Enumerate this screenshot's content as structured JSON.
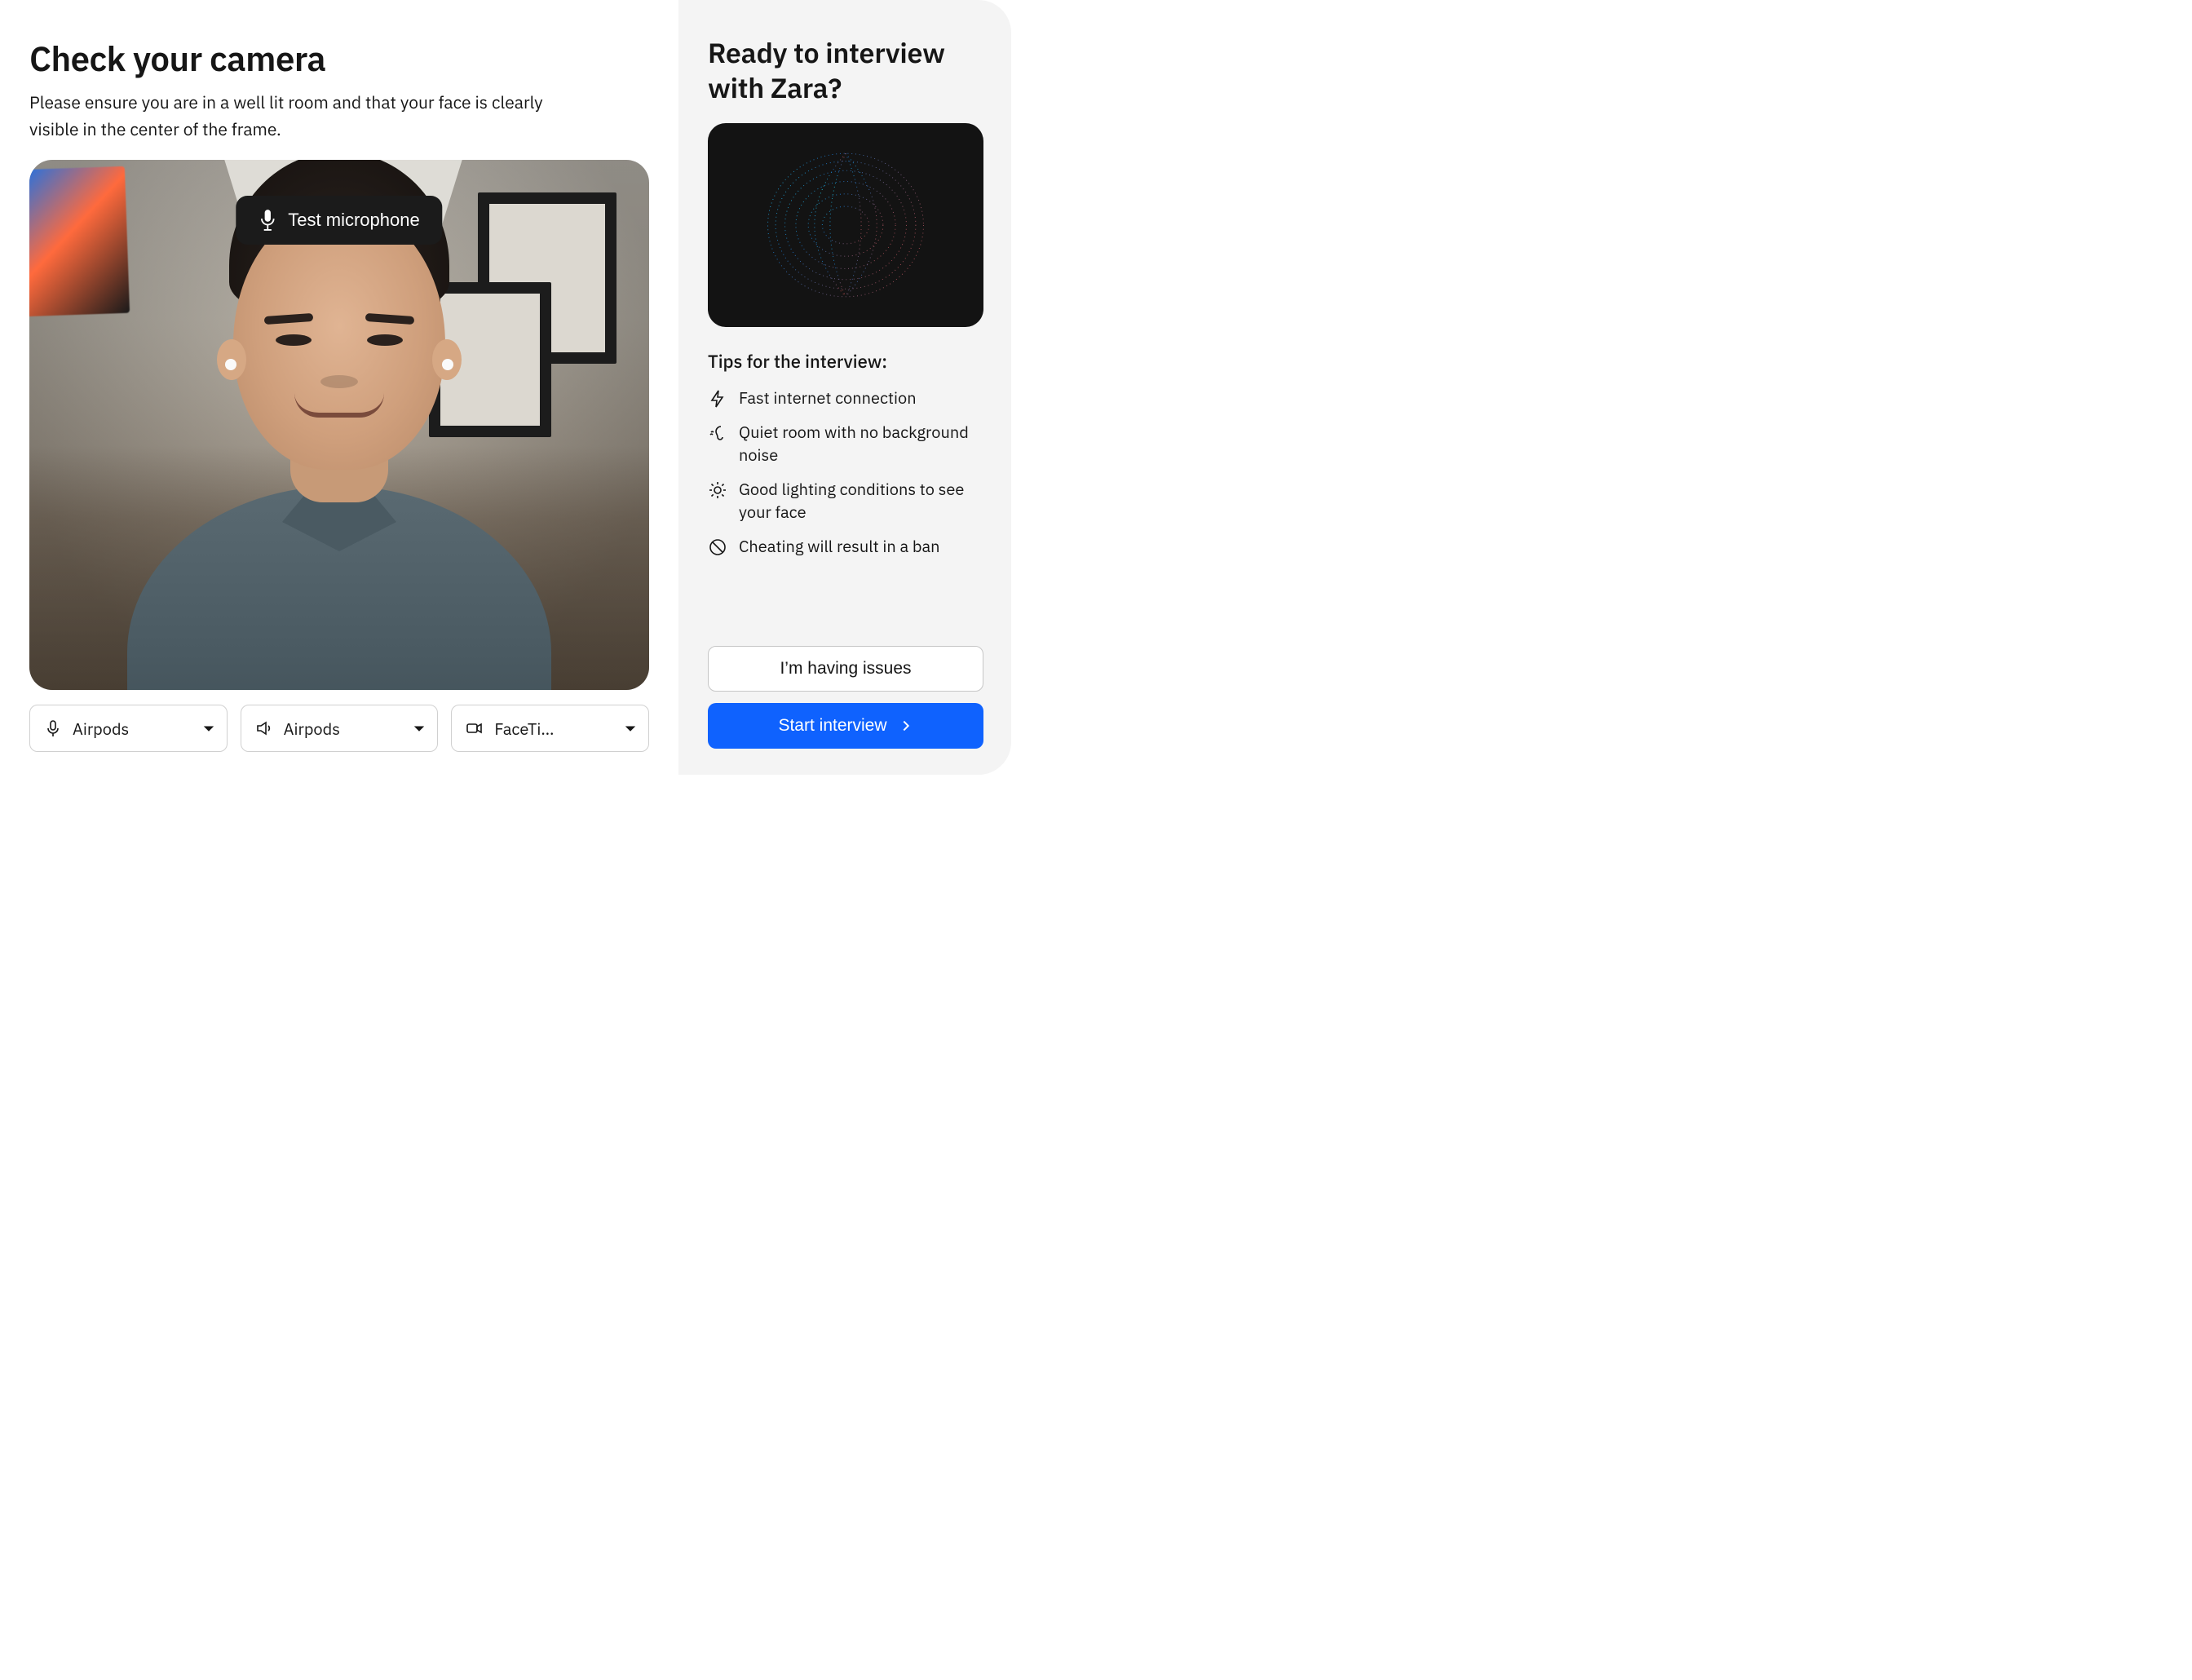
{
  "left": {
    "title": "Check your camera",
    "subtitle": "Please ensure you are in a well lit room and that your face is clearly visible in the center of the frame.",
    "test_mic_label": "Test microphone",
    "devices": {
      "mic": {
        "icon": "microphone-icon",
        "label": "Airpods"
      },
      "speaker": {
        "icon": "speaker-icon",
        "label": "Airpods"
      },
      "camera": {
        "icon": "camera-icon",
        "label": "FaceTi…"
      }
    }
  },
  "right": {
    "heading": "Ready to interview with Zara?",
    "tips_title": "Tips for the interview:",
    "tips": [
      {
        "icon": "bolt-icon",
        "text": "Fast internet connection"
      },
      {
        "icon": "ear-icon",
        "text": "Quiet room with no background noise"
      },
      {
        "icon": "sun-icon",
        "text": "Good lighting conditions to see your face"
      },
      {
        "icon": "ban-icon",
        "text": "Cheating will result in a ban"
      }
    ],
    "issues_label": "I’m having issues",
    "start_label": "Start interview"
  },
  "colors": {
    "primary": "#0f62fe",
    "panel": "#f4f4f4",
    "orb_bg": "#131313"
  }
}
